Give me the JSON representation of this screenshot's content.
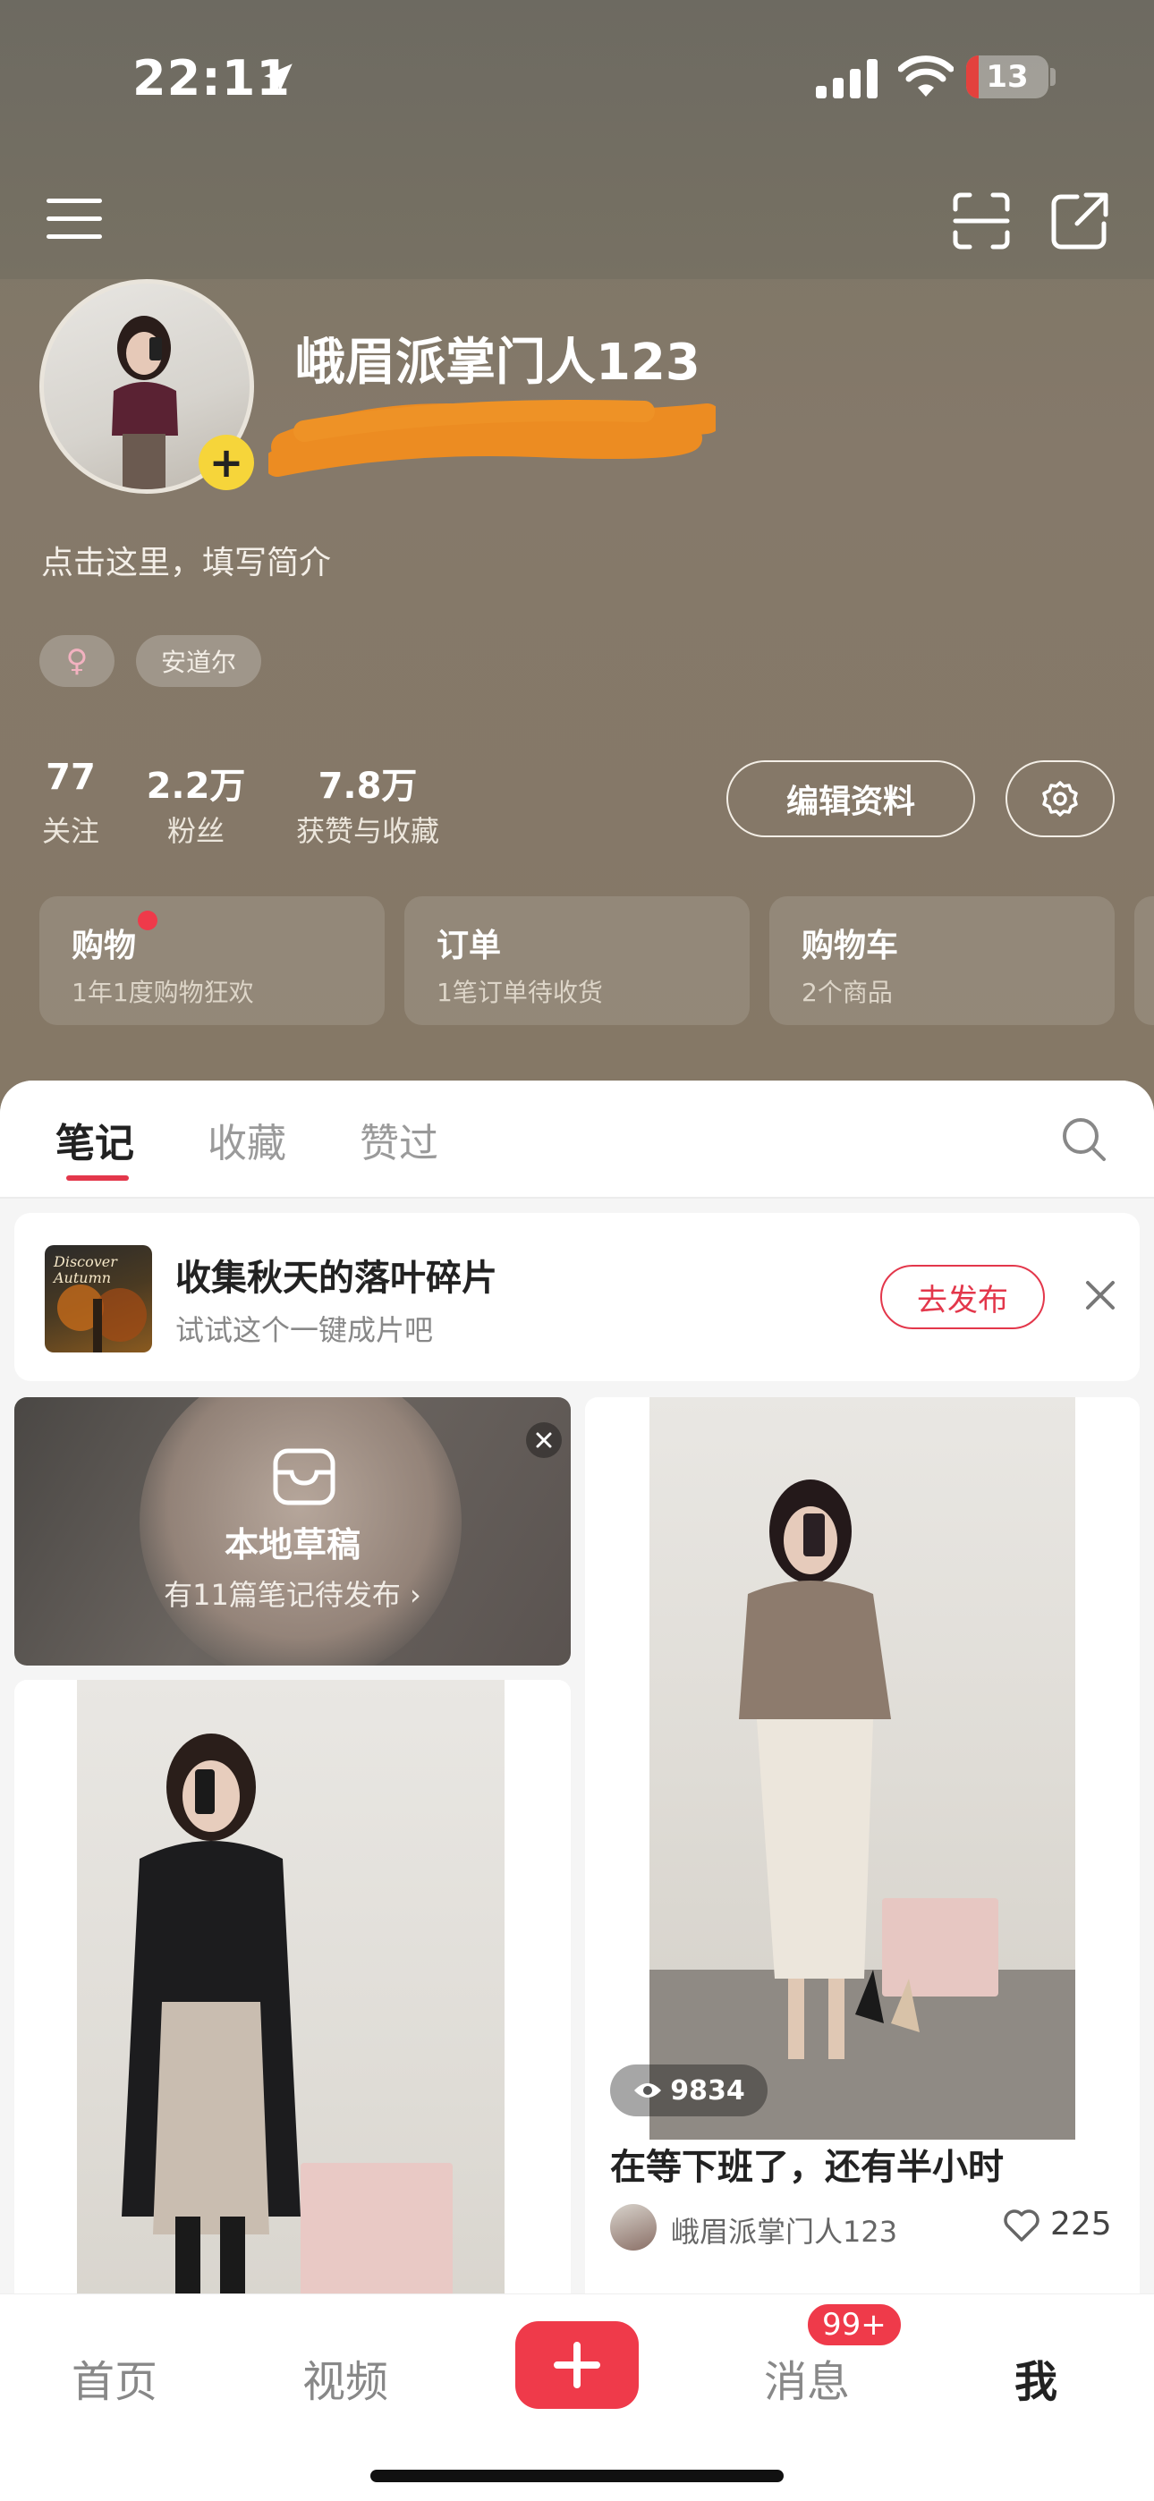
{
  "status_bar": {
    "time": "22:11",
    "battery": "13"
  },
  "profile": {
    "username": "峨眉派掌门人123",
    "bio": "点击这里，填写简介",
    "gender_icon": "♀",
    "location_tag": "安道尔",
    "avatar_add": "+"
  },
  "stats": [
    {
      "value": "77",
      "label": "关注"
    },
    {
      "value": "2.2万",
      "label": "粉丝"
    },
    {
      "value": "7.8万",
      "label": "获赞与收藏"
    }
  ],
  "actions": {
    "edit_profile": "编辑资料"
  },
  "cards": [
    {
      "title": "购物",
      "subtitle": "1年1度购物狂欢",
      "has_dot": true
    },
    {
      "title": "订单",
      "subtitle": "1笔订单待收货"
    },
    {
      "title": "购物车",
      "subtitle": "2个商品"
    }
  ],
  "tabs": [
    {
      "label": "笔记",
      "active": true
    },
    {
      "label": "收藏"
    },
    {
      "label": "赞过"
    }
  ],
  "promo": {
    "thumb_text": "Discover Autumn",
    "title": "收集秋天的落叶碎片",
    "subtitle": "试试这个一键成片吧",
    "button": "去发布"
  },
  "draft": {
    "title": "本地草稿",
    "subtitle": "有11篇笔记待发布 ›"
  },
  "note": {
    "views": "9834",
    "title": "在等下班了，还有半小时",
    "author": "峨眉派掌门人123",
    "likes": "225"
  },
  "bottom_nav": [
    {
      "label": "首页"
    },
    {
      "label": "视频"
    },
    {
      "label": "消息",
      "badge": "99+"
    },
    {
      "label": "我",
      "active": true
    }
  ],
  "colors": {
    "accent": "#ef3a4a",
    "header_bg": "#857866",
    "avatar_add": "#f6d53a"
  }
}
